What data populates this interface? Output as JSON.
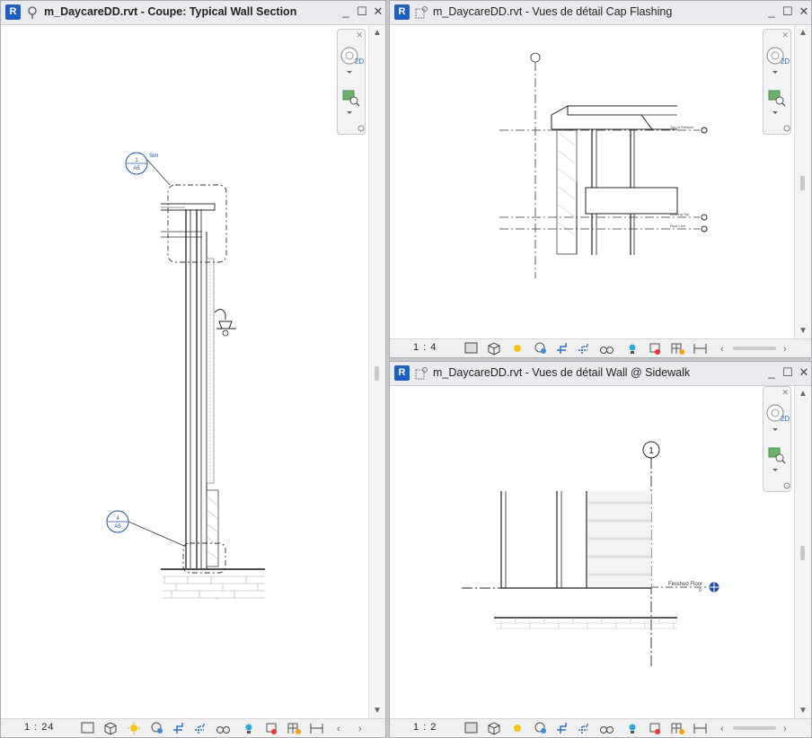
{
  "windows": {
    "left": {
      "title": "m_DaycareDD.rvt - Coupe: Typical Wall Section",
      "scale": "1 : 24",
      "callout_top": {
        "number": "1",
        "sheet": "A5",
        "tag": "Sim"
      },
      "callout_bottom": {
        "number": "4",
        "sheet": "A5"
      }
    },
    "top_right": {
      "title": "m_DaycareDD.rvt - Vues de détail Cap Flashing",
      "scale": "1 : 4",
      "grid_bubble": "",
      "level_labels": [
        "Top of Parapet",
        "Bearing Top",
        "Roof Line"
      ]
    },
    "bottom_right": {
      "title": "m_DaycareDD.rvt - Vues de détail Wall @ Sidewalk",
      "scale": "1 : 2",
      "grid_bubble": "1",
      "level_label": "Finished Floor",
      "level_value": "0"
    }
  },
  "logo_letter": "R",
  "window_buttons": {
    "minimize": "_",
    "maximize": "☐",
    "close": "✕"
  },
  "nav_bar": {
    "wheel_label": "2D"
  },
  "colors": {
    "logo": "#1f5fbf",
    "annotation": "#1f4fa3"
  }
}
